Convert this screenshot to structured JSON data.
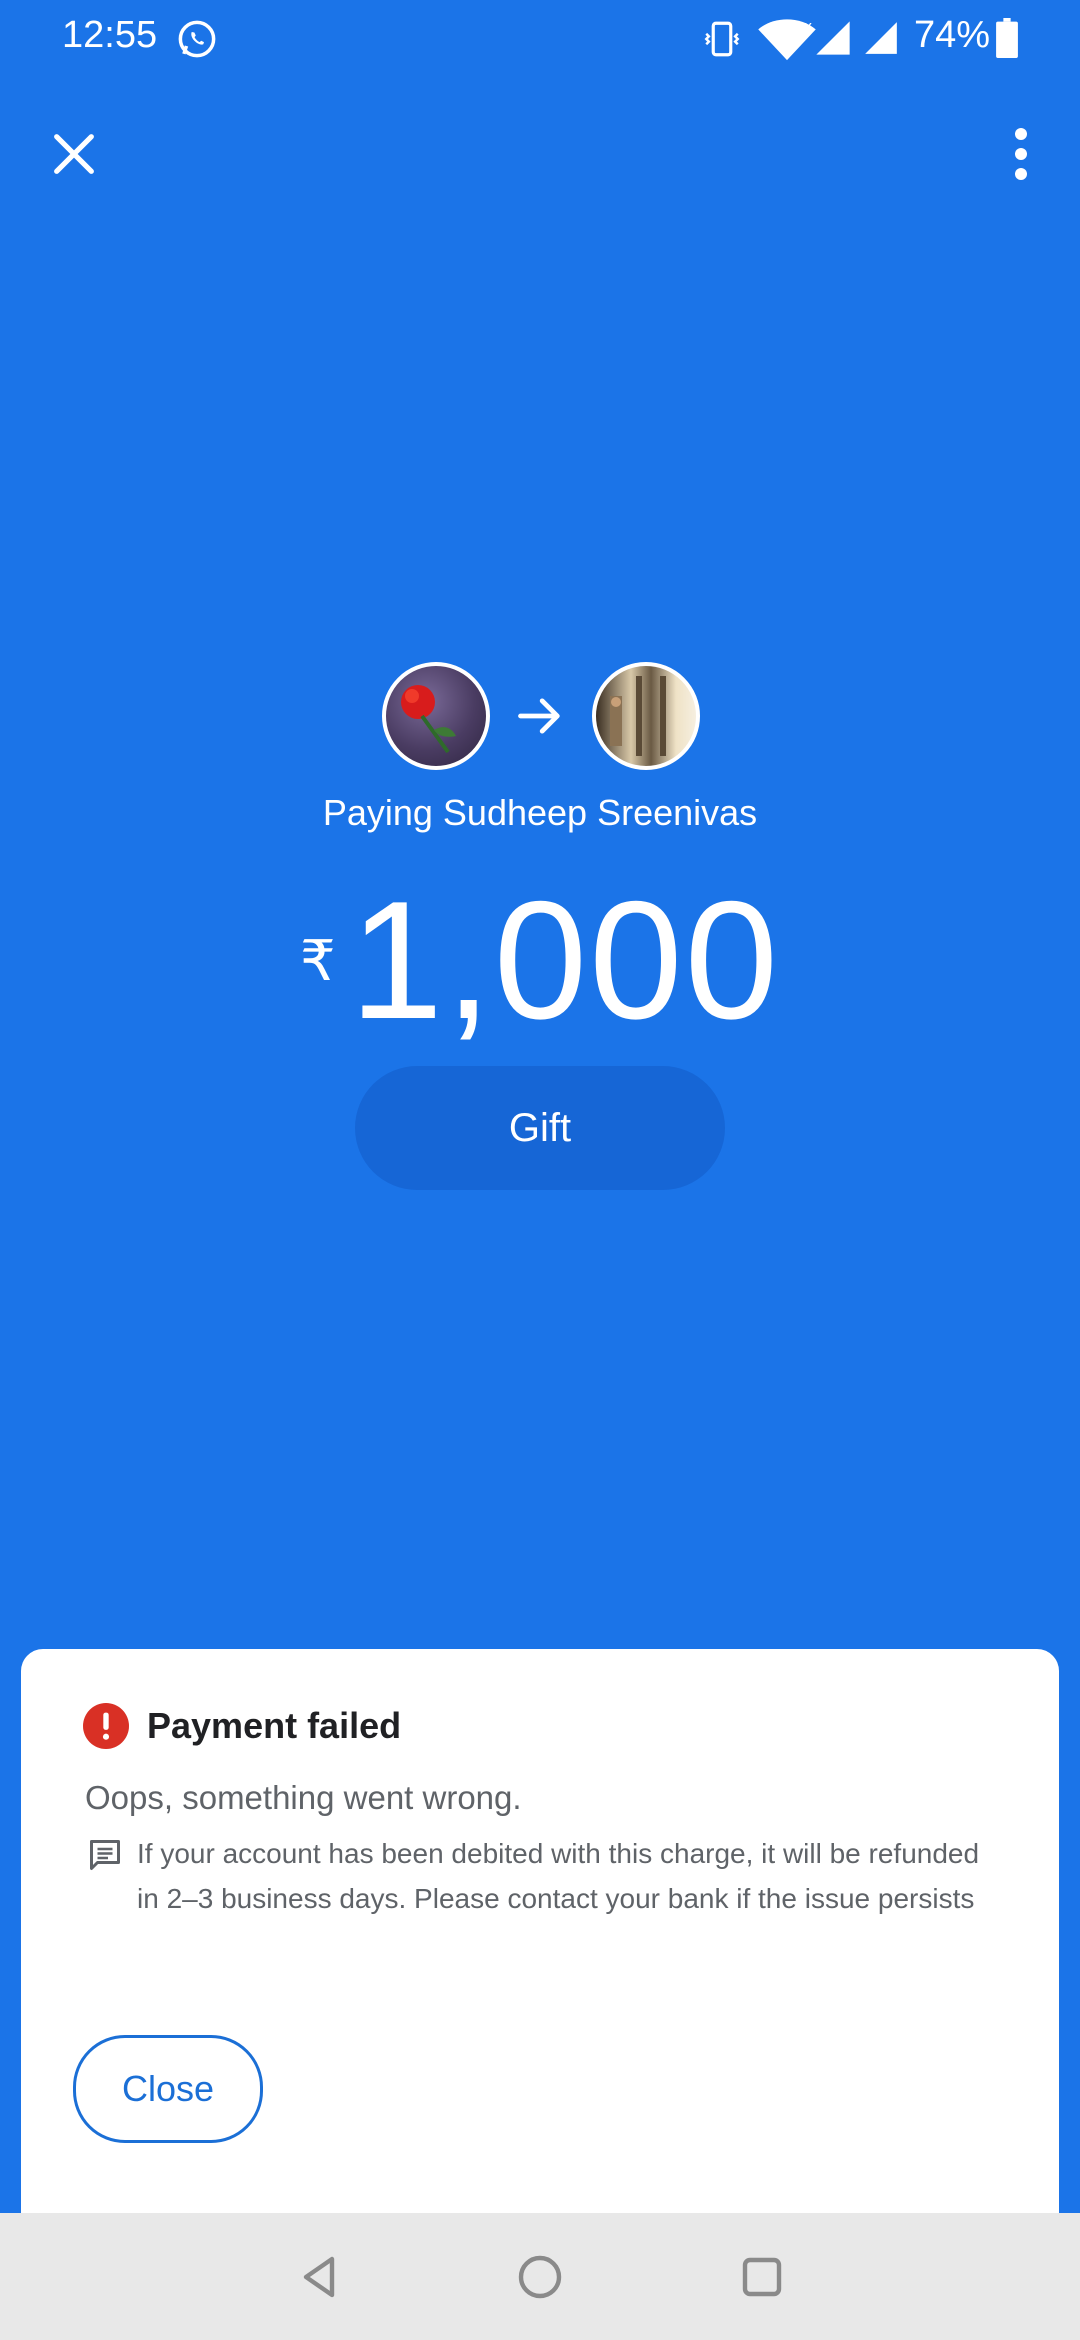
{
  "status_bar": {
    "time": "12:55",
    "battery": "74%",
    "icons": [
      "whatsapp-icon",
      "vibrate-icon",
      "wifi-icon",
      "signal-icon",
      "battery-icon"
    ]
  },
  "top_bar": {
    "close_icon": "close-icon",
    "more_icon": "more-vert-icon"
  },
  "payment": {
    "paying_text": "Paying Sudheep Sreenivas",
    "currency_symbol": "₹",
    "amount": "1,000",
    "gift_label": "Gift"
  },
  "sheet": {
    "title": "Payment failed",
    "message": "Oops, something went wrong.",
    "note": "If your account has been debited with this charge, it will be refunded in 2–3 business days. Please contact your bank if the issue persists",
    "close_label": "Close",
    "error_color": "#d93025",
    "accent_color": "#1b6fd6"
  },
  "colors": {
    "background": "#1b74e8",
    "gift_pill": "#1666d6"
  }
}
